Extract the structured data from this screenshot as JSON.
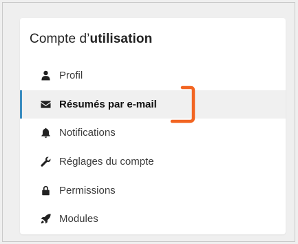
{
  "panel": {
    "title_prefix": "Compte d’",
    "title_strong": "utilisation"
  },
  "menu": {
    "items": [
      {
        "label": "Profil",
        "icon": "user-icon",
        "active": false
      },
      {
        "label": "Résumés par e-mail",
        "icon": "envelope-icon",
        "active": true
      },
      {
        "label": "Notifications",
        "icon": "bell-icon",
        "active": false
      },
      {
        "label": "Réglages du compte",
        "icon": "wrench-icon",
        "active": false
      },
      {
        "label": "Permissions",
        "icon": "lock-icon",
        "active": false
      },
      {
        "label": "Modules",
        "icon": "rocket-icon",
        "active": false
      }
    ]
  },
  "colors": {
    "active_indicator": "#3a8cbf",
    "annotation": "#f26522"
  }
}
